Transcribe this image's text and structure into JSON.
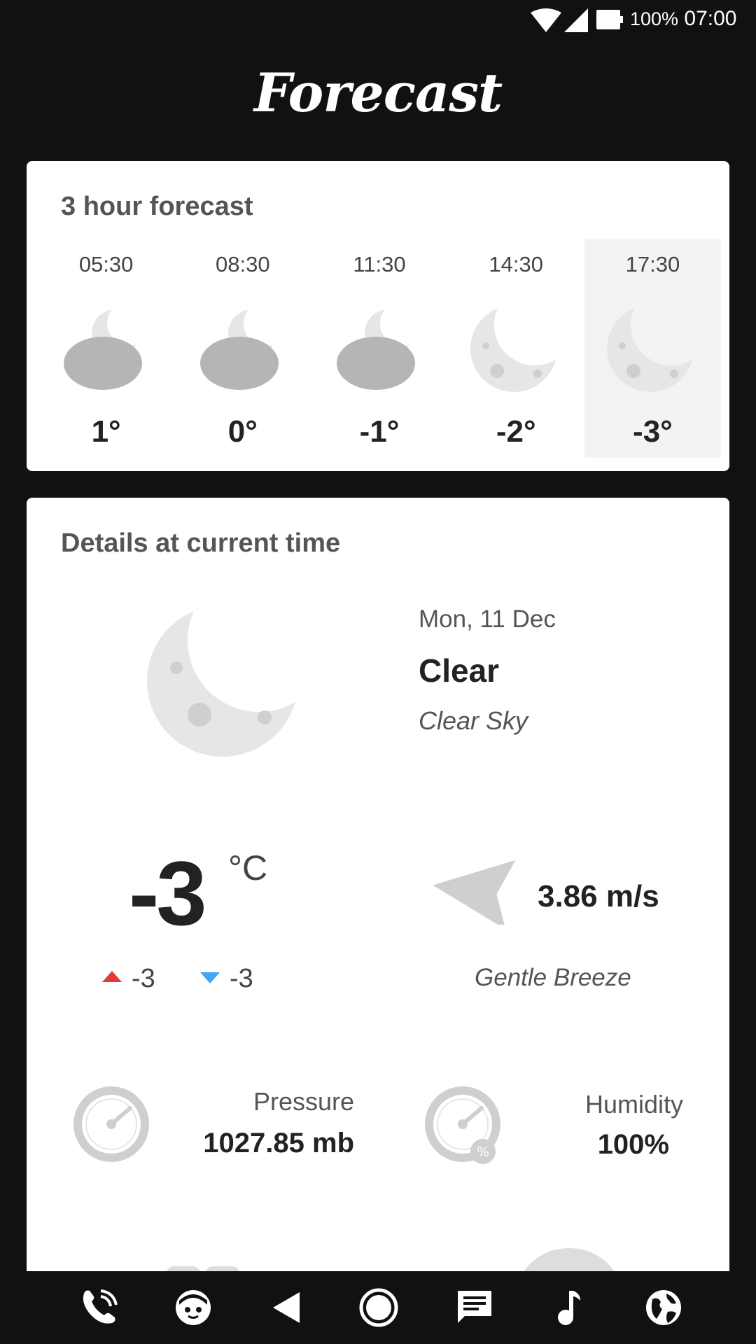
{
  "status_bar": {
    "battery_percent": "100%",
    "time": "07:00"
  },
  "header": {
    "title": "Forecast"
  },
  "hourly": {
    "title": "3 hour forecast",
    "items": [
      {
        "time": "05:30",
        "temp": "1°",
        "icon": "partly-cloudy-night-icon"
      },
      {
        "time": "08:30",
        "temp": "0°",
        "icon": "partly-cloudy-night-icon"
      },
      {
        "time": "11:30",
        "temp": "-1°",
        "icon": "partly-cloudy-night-icon"
      },
      {
        "time": "14:30",
        "temp": "-2°",
        "icon": "moon-icon"
      },
      {
        "time": "17:30",
        "temp": "-3°",
        "icon": "moon-icon",
        "selected": true
      }
    ]
  },
  "details": {
    "title": "Details at current time",
    "date": "Mon, 11 Dec",
    "condition": "Clear",
    "description": "Clear Sky",
    "temperature": "-3",
    "unit": "°C",
    "temp_max": "-3",
    "temp_min": "-3",
    "wind_speed": "3.86 m/s",
    "wind_description": "Gentle Breeze",
    "pressure_label": "Pressure",
    "pressure_value": "1027.85 mb",
    "humidity_label": "Humidity",
    "humidity_value": "100%"
  },
  "colors": {
    "background": "#111111",
    "card": "#ffffff",
    "icon_gray": "#cfcfcf",
    "cloud_gray": "#b5b5b5",
    "temp_up": "#e53935",
    "temp_down": "#42a5f5"
  },
  "nav_bar": {
    "icons": [
      "phone-icon",
      "messenger-icon",
      "back-icon",
      "home-icon",
      "messages-icon",
      "music-icon",
      "browser-icon"
    ]
  }
}
